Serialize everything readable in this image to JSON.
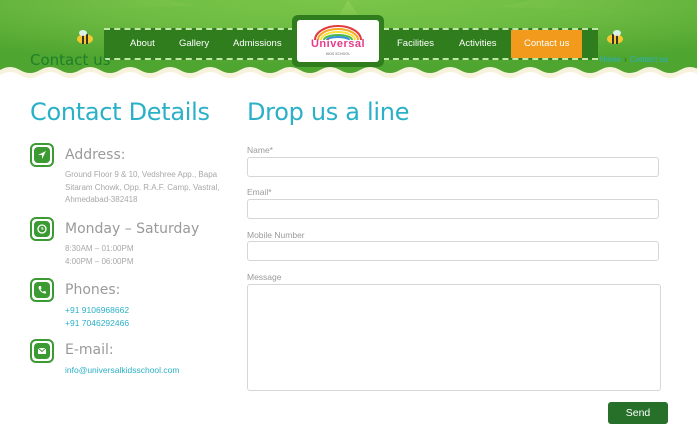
{
  "header": {
    "page_title": "Contact us",
    "nav_left": [
      {
        "label": "About"
      },
      {
        "label": "Gallery"
      },
      {
        "label": "Admissions"
      }
    ],
    "nav_right": [
      {
        "label": "Facilities"
      },
      {
        "label": "Activities"
      },
      {
        "label": "Contact us",
        "active": true
      }
    ],
    "logo_text": "Universal",
    "logo_sub": "KIDS SCHOOL",
    "breadcrumb": {
      "home": "Home",
      "current": "Contact us"
    },
    "colors": {
      "green": "#5fb13a",
      "dark_green": "#2f7d1c",
      "orange": "#f29a1c",
      "teal": "#2ab0c7"
    }
  },
  "contact": {
    "title": "Contact Details",
    "address": {
      "heading": "Address:",
      "lines": [
        "Ground Floor 9 & 10, Vedshree App., Bapa",
        "Sitaram Chowk, Opp. R.A.F. Camp, Vastral,",
        "Ahmedabad-382418"
      ],
      "icon": "location-arrow-icon"
    },
    "hours": {
      "heading": "Monday – Saturday",
      "lines": [
        "8:30AM – 01:00PM",
        "4:00PM – 06:00PM"
      ],
      "icon": "clock-icon"
    },
    "phones": {
      "heading": "Phones:",
      "lines": [
        "+91 9106968662",
        "+91 7046292466"
      ],
      "icon": "phone-icon"
    },
    "email": {
      "heading": "E-mail:",
      "value": "info@universalkidsschool.com",
      "icon": "envelope-icon"
    }
  },
  "form": {
    "title": "Drop us a line",
    "name_label": "Name*",
    "email_label": "Email*",
    "mobile_label": "Mobile Number",
    "message_label": "Message",
    "send_label": "Send"
  }
}
